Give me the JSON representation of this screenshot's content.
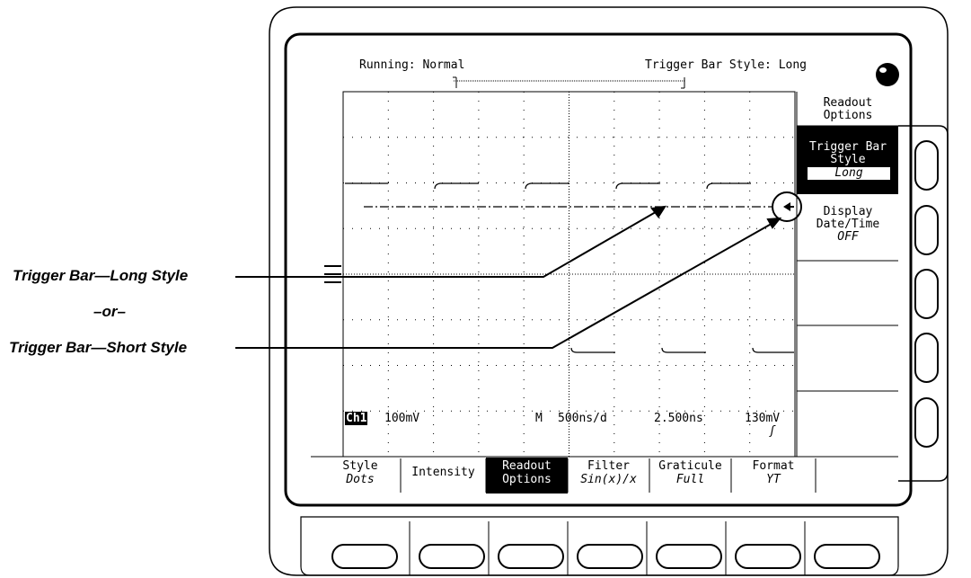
{
  "status": {
    "run_state": "Running: Normal",
    "trigger_bar_style_readout": "Trigger Bar Style: Long"
  },
  "readout": {
    "channel": "Ch1",
    "volts_per_div": "100mV",
    "timebase_prefix": "M",
    "time_per_div": "500ns/d",
    "trigger_delay": "2.500ns",
    "trigger_level": "130mV",
    "trigger_slope_icon": "rising-edge-icon"
  },
  "side_menu": {
    "title_line1": "Readout",
    "title_line2": "Options",
    "items": [
      {
        "line1": "Trigger Bar",
        "line2": "Style",
        "value": "Long"
      },
      {
        "line1": "Display",
        "line2": "Date/Time",
        "value": "OFF"
      }
    ]
  },
  "bottom_menu": [
    {
      "label": "Style",
      "value": "Dots"
    },
    {
      "label": "Intensity",
      "value": ""
    },
    {
      "label": "Readout",
      "value": "Options"
    },
    {
      "label": "Filter",
      "value": "Sin(x)/x"
    },
    {
      "label": "Graticule",
      "value": "Full"
    },
    {
      "label": "Format",
      "value": "YT"
    }
  ],
  "callouts": {
    "long": "Trigger Bar—Long Style",
    "or": "–or–",
    "short": "Trigger Bar—Short Style"
  },
  "icons": {
    "power_knob": "knob-icon",
    "short_trigger_indicator": "trigger-arrow-left-icon"
  }
}
